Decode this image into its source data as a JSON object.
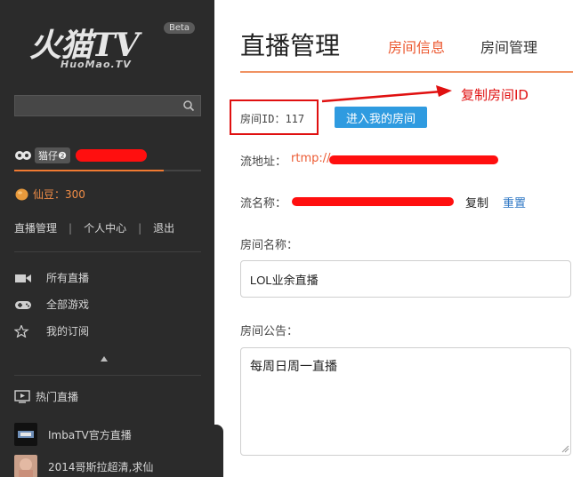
{
  "sidebar": {
    "logo": "火猫TV",
    "logo_sub": "HuoMao.TV",
    "beta": "Beta",
    "search_placeholder": "",
    "user_rank": "猫仔❷",
    "coins": "仙豆：300",
    "user_links": [
      "直播管理",
      "个人中心",
      "退出"
    ],
    "separator": "|",
    "nav": [
      {
        "label": "所有直播",
        "icon": "video-camera-icon"
      },
      {
        "label": "全部游戏",
        "icon": "gamepad-icon"
      },
      {
        "label": "我的订阅",
        "icon": "star-icon"
      }
    ],
    "hot_title": "热门直播",
    "streams": [
      {
        "label": "ImbaTV官方直播"
      },
      {
        "label": "2014哥斯拉超清,求仙"
      }
    ]
  },
  "main": {
    "title": "直播管理",
    "tabs": [
      "房间信息",
      "房间管理"
    ],
    "room_id_label": "房间ID：117",
    "enter_room": "进入我的房间",
    "annotation": "复制房间ID",
    "stream_url_label": "流地址：",
    "stream_url_prefix": "rtmp://",
    "stream_name_label": "流名称：",
    "copy": "复制",
    "reset": "重置",
    "room_name_label": "房间名称：",
    "room_name_value": "LOL业余直播",
    "notice_label": "房间公告：",
    "notice_value": "每周日周一直播"
  },
  "colors": {
    "sidebar_bg": "#2b2b2b",
    "accent_orange": "#ec5a32",
    "button_blue": "#2f9be0",
    "annotation_red": "#e01010"
  }
}
